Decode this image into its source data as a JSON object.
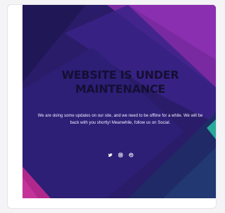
{
  "page": {
    "title": "WEBSITE IS UNDER MAINTENANCE",
    "message": "We are doing some updates on our site, and we need to be offline for a while. We will be back with you shortly! Meanwhile, follow us on Social."
  },
  "social": {
    "icons": [
      "twitter-icon",
      "instagram-icon",
      "dribbble-icon"
    ]
  },
  "colors": {
    "background_base": "#2a1c68",
    "accent_purple": "#8a2aa8",
    "accent_magenta": "#b0288c",
    "accent_teal": "#2aa89a",
    "title_color": "#140f33",
    "text_color": "#f0ecff"
  }
}
